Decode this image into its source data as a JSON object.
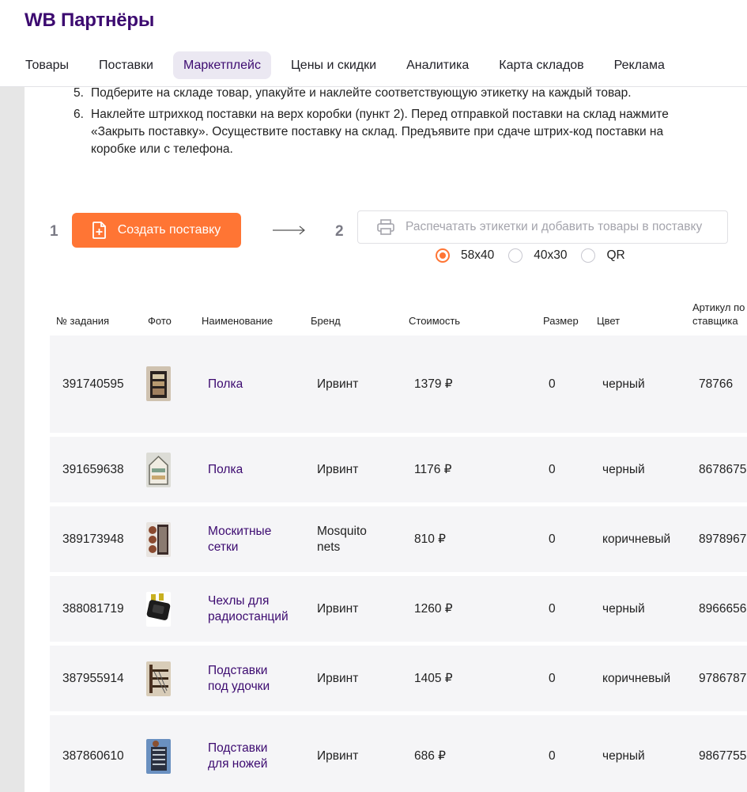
{
  "header": {
    "logo": "WB Партнёры",
    "nav": [
      "Товары",
      "Поставки",
      "Маркетплейс",
      "Цены и скидки",
      "Аналитика",
      "Карта складов",
      "Реклама"
    ],
    "active_nav": "Маркетплейс",
    "accent_color": "#3c0a70"
  },
  "instructions": [
    {
      "num": "5.",
      "text": "Подберите на складе товар, упакуйте и наклейте соответствующую этикетку на каждый товар."
    },
    {
      "num": "6.",
      "text": "Наклейте штрихкод поставки на верх коробки (пункт 2). Перед отправкой поставки на склад нажмите «Закрыть поставку». Осуществите поставку на склад. Предъявите при сдаче штрих-код поставки на коробке или с телефона."
    }
  ],
  "steps": {
    "step1_num": "1",
    "create_label": "Создать поставку",
    "step2_num": "2",
    "print_label": "Распечатать этикетки и добавить товары в поставку",
    "button_color": "#ff7534"
  },
  "label_formats": {
    "options": [
      "58x40",
      "40x30",
      "QR"
    ],
    "selected": "58x40"
  },
  "table": {
    "headers": {
      "id": "№ задания",
      "photo": "Фото",
      "name": "Наименование",
      "brand": "Бренд",
      "price": "Стоимость",
      "size": "Размер",
      "color": "Цвет",
      "article": "Артикул поставщика"
    },
    "rows": [
      {
        "id": "391740595",
        "name": "Полка",
        "brand": "Ирвинт",
        "price": "1379 ₽",
        "size": "0",
        "color": "черный",
        "article": "78766",
        "photo_icon": "shelf-photo-icon"
      },
      {
        "id": "391659638",
        "name": "Полка",
        "brand": "Ирвинт",
        "price": "1176 ₽",
        "size": "0",
        "color": "черный",
        "article": "8678675",
        "photo_icon": "shelf-photo-icon"
      },
      {
        "id": "389173948",
        "name": "Москитные сетки",
        "brand": "Mosquito nets",
        "price": "810 ₽",
        "size": "0",
        "color": "коричневый",
        "article": "8978967",
        "photo_icon": "mosquito-net-photo-icon"
      },
      {
        "id": "388081719",
        "name": "Чехлы для радиостанций",
        "brand": "Ирвинт",
        "price": "1260 ₽",
        "size": "0",
        "color": "черный",
        "article": "8966656",
        "photo_icon": "radio-case-photo-icon"
      },
      {
        "id": "387955914",
        "name": "Подставки под удочки",
        "brand": "Ирвинт",
        "price": "1405 ₽",
        "size": "0",
        "color": "коричневый",
        "article": "9786787",
        "photo_icon": "rod-stand-photo-icon"
      },
      {
        "id": "387860610",
        "name": "Подставки для ножей",
        "brand": "Ирвинт",
        "price": "686 ₽",
        "size": "0",
        "color": "черный",
        "article": "9867755",
        "photo_icon": "knife-stand-photo-icon"
      }
    ]
  }
}
